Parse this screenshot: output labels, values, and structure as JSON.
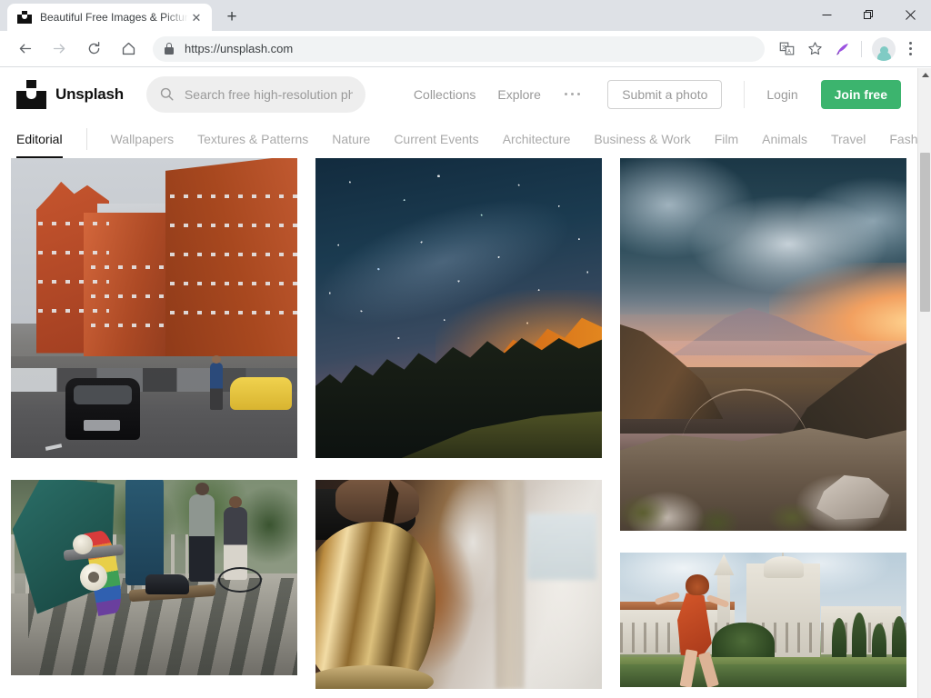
{
  "browser": {
    "tab": {
      "title": "Beautiful Free Images & Pictures",
      "favicon": "unsplash-favicon",
      "close_label": "✕"
    },
    "new_tab_label": "+",
    "window_controls": {
      "minimize": "minimize-icon",
      "restore": "restore-icon",
      "close": "close-icon"
    },
    "toolbar": {
      "back": "back-arrow-icon",
      "forward": "forward-arrow-icon",
      "reload": "reload-icon",
      "home": "home-icon",
      "url": "https://unsplash.com",
      "security": "lock-icon",
      "translate": "translate-icon",
      "bookmark": "star-icon",
      "extension": "quill-pen-icon",
      "profile": "avatar-icon",
      "menu": "three-dot-menu-icon"
    }
  },
  "site": {
    "logo_text": "Unsplash",
    "search": {
      "placeholder": "Search free high-resolution pho",
      "value": "",
      "icon": "search-icon"
    },
    "nav": [
      {
        "label": "Collections"
      },
      {
        "label": "Explore"
      }
    ],
    "more_label": "•••",
    "actions": {
      "submit_label": "Submit a photo",
      "login_label": "Login",
      "join_label": "Join free",
      "join_color": "#3cb46e"
    },
    "tabs": [
      {
        "label": "Editorial",
        "active": true
      },
      {
        "label": "Wallpapers",
        "active": false
      },
      {
        "label": "Textures & Patterns",
        "active": false
      },
      {
        "label": "Nature",
        "active": false
      },
      {
        "label": "Current Events",
        "active": false
      },
      {
        "label": "Architecture",
        "active": false
      },
      {
        "label": "Business & Work",
        "active": false
      },
      {
        "label": "Film",
        "active": false
      },
      {
        "label": "Animals",
        "active": false
      },
      {
        "label": "Travel",
        "active": false
      },
      {
        "label": "Fashi",
        "active": false
      }
    ],
    "photos": [
      {
        "id": "photo-london-street",
        "alt": "Red brick Victorian buildings on a London street with a black taxi and yellow car"
      },
      {
        "id": "photo-starry-forest",
        "alt": "Starry night sky and Milky Way above an orange-lit forested hillside"
      },
      {
        "id": "photo-mountain-sunset",
        "alt": "Dramatic sunset over a rocky mountain valley with clouds"
      },
      {
        "id": "photo-skate-park",
        "alt": "Low angle view of skateboarders at a skate park with a rainbow deck"
      },
      {
        "id": "photo-coffee-kettle",
        "alt": "Brass gooseneck kettle pouring coffee in a cafe"
      },
      {
        "id": "photo-lisbon-monastery",
        "alt": "Woman in an orange dress walking past the Jeronimos Monastery in Lisbon"
      }
    ]
  }
}
